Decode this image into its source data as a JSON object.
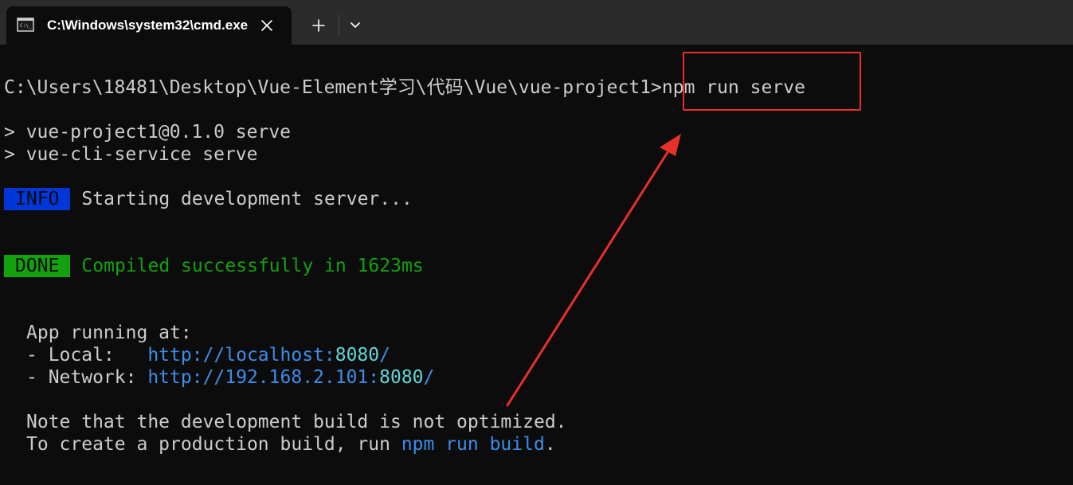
{
  "window": {
    "tab": {
      "title": "C:\\Windows\\system32\\cmd.exe",
      "icon": "terminal-icon",
      "close_icon": "close-icon"
    },
    "new_tab_icon": "plus-icon",
    "dropdown_icon": "chevron-down-icon"
  },
  "console": {
    "prompt": "C:\\Users\\18481\\Desktop\\Vue-Element学习\\代码\\Vue\\vue-project1>",
    "command": "npm run serve",
    "script_line_1": "> vue-project1@0.1.0 serve",
    "script_line_2": "> vue-cli-service serve",
    "info": {
      "badge": "INFO",
      "text": "Starting development server..."
    },
    "done": {
      "badge": "DONE",
      "text": "Compiled successfully in 1623ms"
    },
    "app_running": "App running at:",
    "local": {
      "label": "- Local:   ",
      "url": "http://localhost:",
      "port": "8080",
      "trailing": "/"
    },
    "network": {
      "label": "- Network: ",
      "url": "http://192.168.2.101:",
      "port": "8080",
      "trailing": "/"
    },
    "note_line_1": "Note that the development build is not optimized.",
    "note_line_2_prefix": "To create a production build, run ",
    "note_line_2_command": "npm run build",
    "note_line_2_suffix": "."
  },
  "colors": {
    "background": "#0c0c0c",
    "foreground": "#cccccc",
    "info_badge": "#0037da",
    "done_badge": "#13a10e",
    "link": "#3b8eea",
    "port": "#61d6d6",
    "annotation": "#e8302a"
  }
}
